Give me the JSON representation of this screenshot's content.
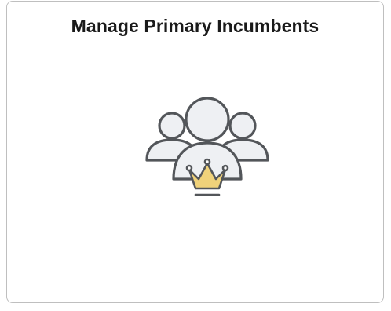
{
  "tile": {
    "title": "Manage Primary Incumbents",
    "icon": "primary-incumbents-icon"
  },
  "colors": {
    "icon_fill": "#eef0f3",
    "icon_stroke": "#53565a",
    "crown_fill": "#f0d27a",
    "border": "#bfbfbf"
  }
}
